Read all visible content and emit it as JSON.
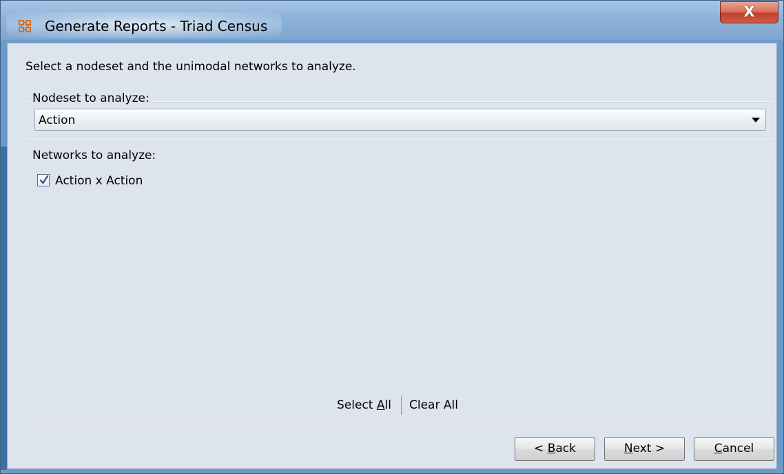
{
  "window": {
    "title": "Generate Reports - Triad Census",
    "close_label": "X"
  },
  "instructions": "Select a nodeset and the unimodal networks to analyze.",
  "nodeset": {
    "label": "Nodeset to analyze:",
    "selected": "Action"
  },
  "networks": {
    "label": "Networks to analyze:",
    "items": [
      {
        "label": "Action x Action",
        "checked": true
      }
    ],
    "select_all_pre": "Select ",
    "select_all_mnemonic": "A",
    "select_all_post": "ll",
    "clear_all": "Clear All"
  },
  "buttons": {
    "back_pre": "< ",
    "back_mnemonic": "B",
    "back_post": "ack",
    "next_mnemonic": "N",
    "next_post": "ext >",
    "cancel_mnemonic": "C",
    "cancel_post": "ancel"
  },
  "colors": {
    "titlebar": "#8fb4db",
    "client_bg": "#dde4ee",
    "close_button": "#c2402a",
    "app_icon": "#e8a030"
  },
  "icons": {
    "app": "network-grid-icon",
    "close": "close-icon",
    "dropdown": "chevron-down-icon",
    "check": "checkmark-icon"
  }
}
